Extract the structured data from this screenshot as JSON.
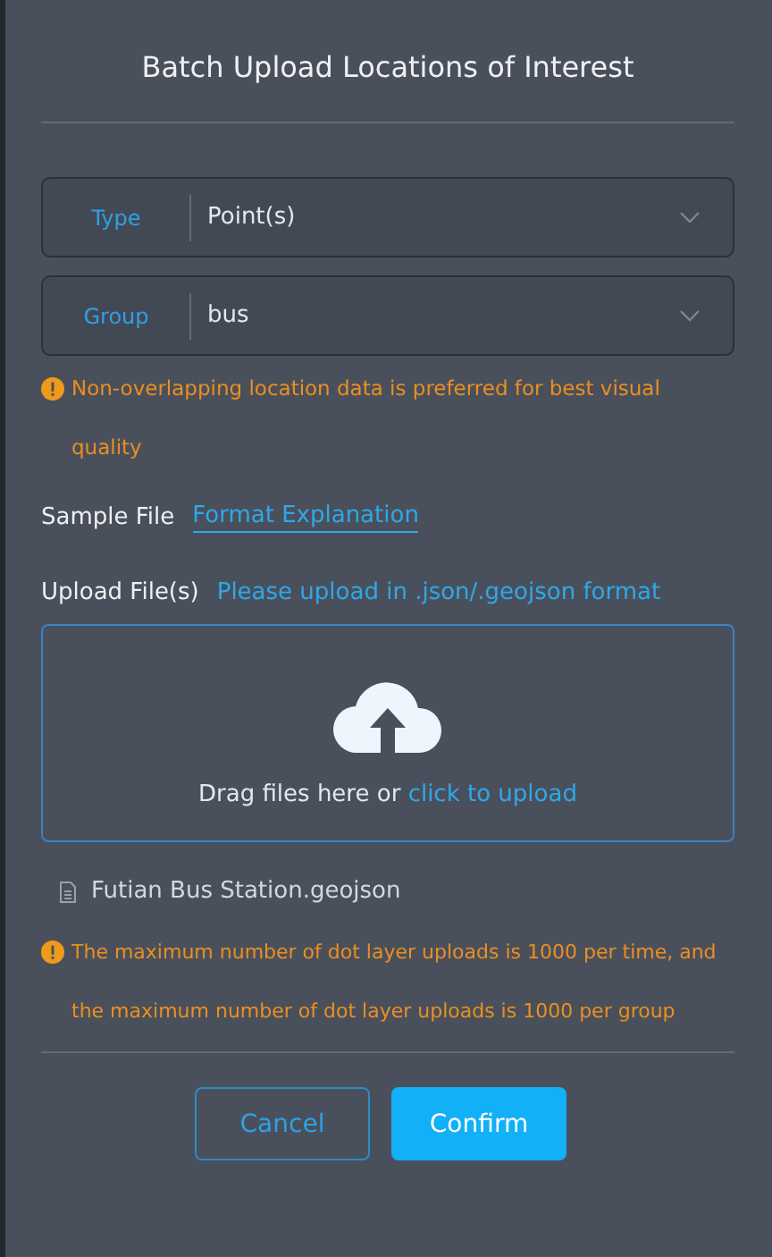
{
  "dialog": {
    "title": "Batch Upload Locations of Interest"
  },
  "selects": [
    {
      "label": "Type",
      "value": "Point(s)"
    },
    {
      "label": "Group",
      "value": "bus"
    }
  ],
  "group_warning": "Non-overlapping location data is preferred for best visual quality",
  "sample_file": {
    "label": "Sample File",
    "link": "Format Explanation"
  },
  "upload": {
    "label": "Upload File(s)",
    "hint": "Please upload in .json/.geojson format",
    "drop_text": "Drag files here or",
    "drop_link": "click to upload"
  },
  "files": [
    {
      "name": "Futian Bus Station.geojson"
    }
  ],
  "limit_warning": "The maximum number of dot layer uploads is 1000 per time, and the maximum number of dot layer uploads is 1000 per group",
  "buttons": [
    {
      "label": "Cancel",
      "kind": "secondary"
    },
    {
      "label": "Confirm",
      "kind": "primary"
    }
  ]
}
